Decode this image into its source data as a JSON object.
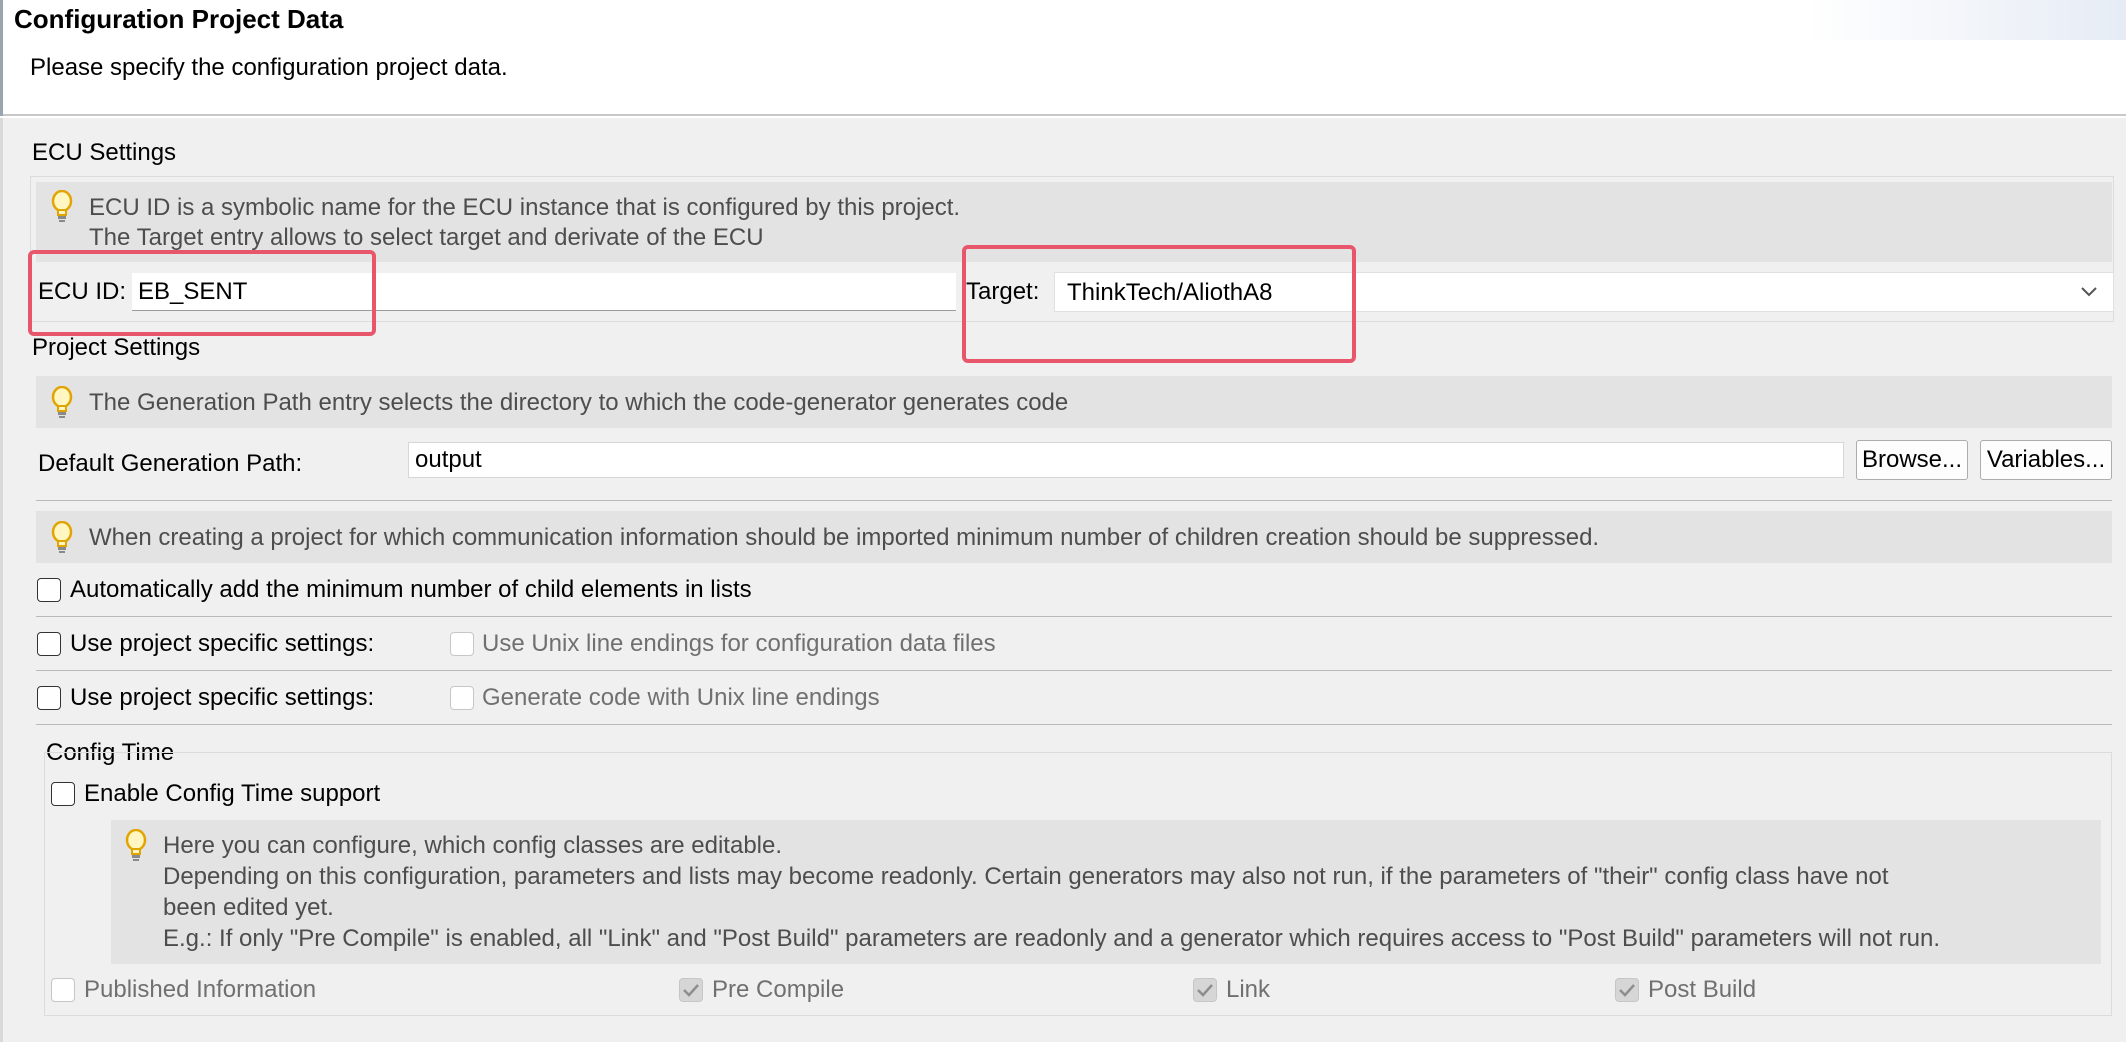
{
  "header": {
    "title": "Configuration Project Data",
    "subtitle": "Please specify the configuration project data."
  },
  "ecu_settings": {
    "group_label": "ECU Settings",
    "hint_line1": "ECU ID is a symbolic name for the ECU instance that is configured by this project.",
    "hint_line2": "The Target entry allows to select target and derivate of the ECU",
    "ecu_id_label": "ECU ID:",
    "ecu_id_value": "EB_SENT",
    "target_label": "Target:",
    "target_value": "ThinkTech/AliothA8"
  },
  "project_settings": {
    "group_label": "Project Settings",
    "hint_generation": "The Generation Path entry selects the directory to which the code-generator generates code",
    "gen_path_label": "Default Generation Path:",
    "gen_path_value": "output",
    "browse_label": "Browse...",
    "variables_label": "Variables...",
    "hint_children": "When creating a project for which communication information should be imported minimum number of children creation should be suppressed.",
    "auto_add_label": "Automatically add the minimum number of child elements in lists",
    "use_specific_label_1": "Use project specific settings:",
    "unix_line_endings_label": "Use Unix line endings for configuration data files",
    "use_specific_label_2": "Use project specific settings:",
    "gen_unix_label": "Generate code with Unix line endings"
  },
  "config_time": {
    "group_label": "Config Time",
    "enable_label": "Enable Config Time support",
    "hint_line1": "Here you can configure, which config classes are editable.",
    "hint_line2": "Depending on this configuration, parameters and lists may become readonly. Certain generators may also not run, if the parameters of \"their\" config class have not",
    "hint_line3": "been edited yet.",
    "hint_line4": "E.g.: If only \"Pre Compile\" is enabled, all \"Link\" and \"Post Build\" parameters are readonly and a generator which requires access to \"Post Build\" parameters will not run.",
    "published_label": "Published Information",
    "pre_compile_label": "Pre Compile",
    "link_label": "Link",
    "post_build_label": "Post Build"
  },
  "colors": {
    "highlight": "#e8566c",
    "info_band": "#e3e3e3",
    "background": "#f0f0f0"
  }
}
